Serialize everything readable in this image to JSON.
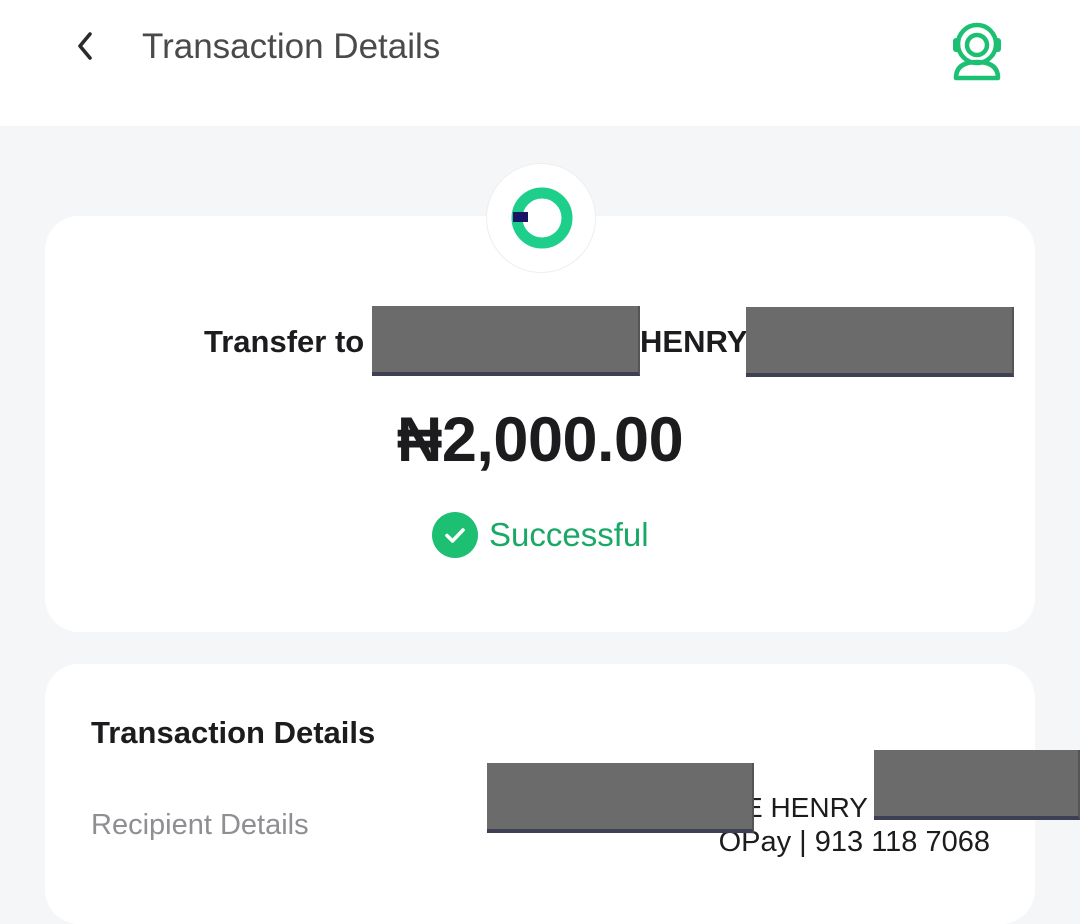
{
  "header": {
    "title": "Transaction Details",
    "back_icon": "chevron-left-icon",
    "support_icon": "customer-support-icon"
  },
  "summary": {
    "logo_icon": "opay-logo-icon",
    "transfer_prefix": "Transfer to",
    "transfer_name_visible": "HENRY",
    "amount": "₦2,000.00",
    "status": "Successful"
  },
  "details": {
    "section_title": "Transaction Details",
    "recipient_label": "Recipient Details",
    "recipient_name_visible": "E HENRY",
    "recipient_bank": "OPay | 913 118 7068"
  },
  "colors": {
    "accent_green": "#1dbf73",
    "status_text": "#1aa866",
    "background": "#f5f6f8",
    "card": "#ffffff",
    "logo_navy": "#1a1464",
    "redaction": "#6b6b6b"
  }
}
